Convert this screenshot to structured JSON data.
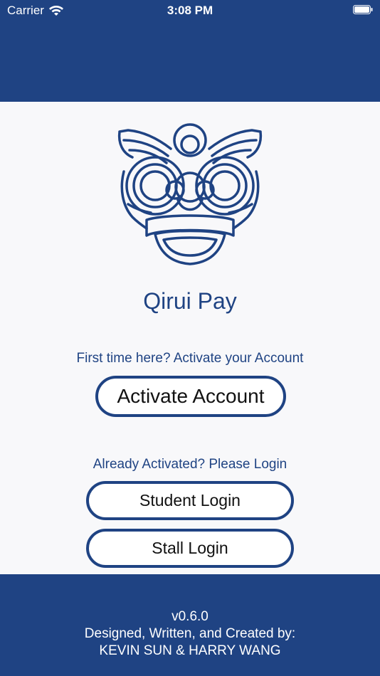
{
  "status_bar": {
    "carrier": "Carrier",
    "time": "3:08 PM",
    "icons": [
      "wifi-icon",
      "battery-icon"
    ]
  },
  "brand": {
    "logo": "lion-dance-head-logo",
    "app_name": "Qirui Pay",
    "primary_color": "#1f4383"
  },
  "activation": {
    "prompt": "First time here? Activate your Account",
    "button_label": "Activate Account"
  },
  "login": {
    "prompt": "Already Activated? Please Login",
    "student_button_label": "Student Login",
    "stall_button_label": "Stall Login"
  },
  "footer": {
    "version": "v0.6.0",
    "credit_line": "Designed, Written, and Created by:",
    "authors": "KEVIN SUN & HARRY WANG"
  }
}
